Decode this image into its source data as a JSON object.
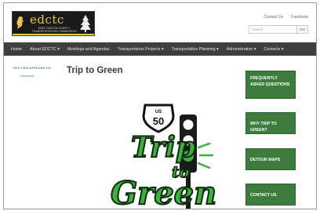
{
  "logo": {
    "brand": "edctc",
    "subtitle": "East Dakota County Transportation Commission"
  },
  "toplinks": {
    "contact": "Contact Us",
    "facebook": "Facebook"
  },
  "search": {
    "placeholder": "Search...",
    "button": "GO"
  },
  "nav": {
    "items": [
      "Home",
      "About EDCTC",
      "Meetings and Agendas",
      "Transportation Projects",
      "Transportation Planning",
      "Administration",
      "Contacts"
    ]
  },
  "sidebar_left": {
    "appears_label": "THIS ITEM APPEARS ON",
    "homepage_link": "Homepage"
  },
  "main": {
    "title": "Trip to Green",
    "artwork": {
      "shield_top": "US",
      "shield_number": "50",
      "word_trip": "Trip",
      "word_to": "to",
      "word_green": "Green"
    }
  },
  "sidebar_right": {
    "buttons": [
      "Frequently Asked Questions",
      "Why Trip to Green?",
      "Detour Maps",
      "Contact Us"
    ]
  },
  "colors": {
    "nav_bg": "#3f3f3f",
    "accent_green": "#3d7c3d",
    "logo_gold": "#e8c650"
  }
}
